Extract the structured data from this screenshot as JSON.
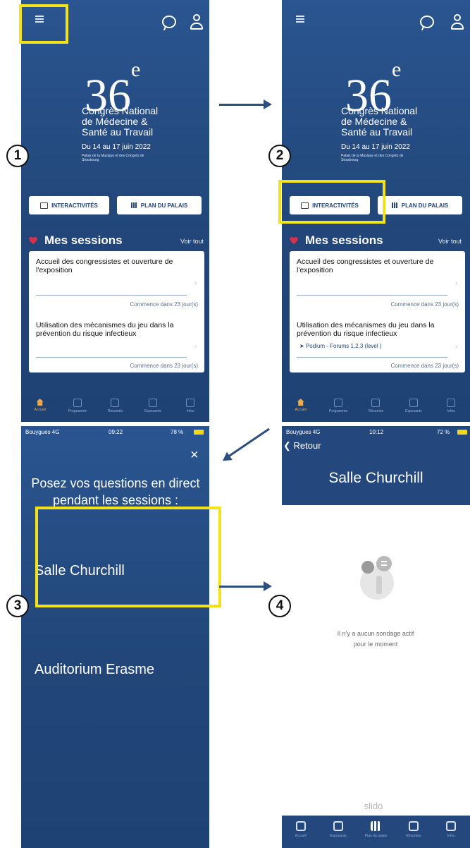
{
  "steps": [
    "1",
    "2",
    "3",
    "4"
  ],
  "colors": {
    "brand_blue": "#254c82",
    "highlight": "#f4e219",
    "accent": "#f2a93b",
    "heart": "#d6334a"
  },
  "app": {
    "big_number": "36",
    "big_number_sup": "e",
    "congress_line1": "Congrès National",
    "congress_line2": "de Médecine &",
    "congress_line3": "Santé au Travail",
    "dates": "Du 14 au 17 juin 2022",
    "venue": "Palais de la Musique et des Congrès de Strasbourg",
    "btn_interactivites": "INTERACTIVITÉS",
    "btn_plan": "PLAN DU PALAIS",
    "mes_sessions": "Mes sessions",
    "voir_tout": "Voir tout",
    "session1_title": "Accueil des congressistes et ouverture de l'exposition",
    "session1_foot": "Commence dans 23 jour(s)",
    "session2_title": "Utilisation des mécanismes du jeu dans la prévention du risque infectieux",
    "session2_room": "Podium - Forums 1,2,3 (level )",
    "session2_foot": "Commence dans 23 jour(s)",
    "tabs": [
      "Accueil",
      "Programme",
      "Résumés",
      "Exposants",
      "Infos"
    ]
  },
  "screen3": {
    "carrier": "Bouygues 4G",
    "time": "09:22",
    "battery": "78 %",
    "close": "×",
    "heading": "Posez vos questions en direct pendant les sessions :",
    "room1": "Salle Churchill",
    "room2": "Auditorium Erasme"
  },
  "screen4": {
    "carrier": "Bouygues 4G",
    "time": "10:12",
    "battery": "72 %",
    "back": "Retour",
    "title": "Salle Churchill",
    "empty_line1": "Il n'y a aucun sondage actif",
    "empty_line2": "pour le moment",
    "footer_brand": "slido",
    "tabs": [
      "Accueil",
      "Exposants",
      "Plan du palais",
      "Résumés",
      "Infos"
    ]
  }
}
